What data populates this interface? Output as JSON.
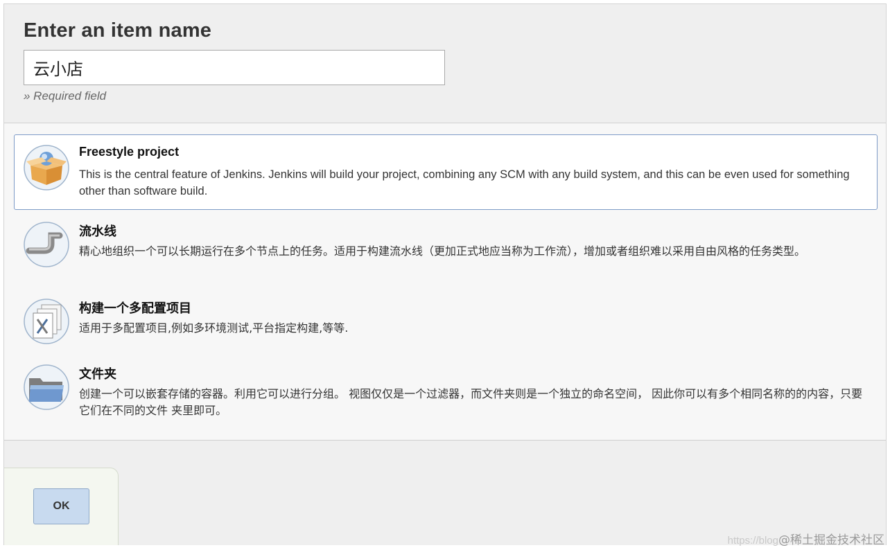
{
  "header": {
    "title": "Enter an item name",
    "item_name_value": "云小店",
    "required_note": "» Required field"
  },
  "items": [
    {
      "title": "Freestyle project",
      "description": "This is the central feature of Jenkins. Jenkins will build your project, combining any SCM with any build system, and this can be even used for something other than software build.",
      "icon": "freestyle-box-icon",
      "selected": true
    },
    {
      "title": "流水线",
      "description": "精心地组织一个可以长期运行在多个节点上的任务。适用于构建流水线（更加正式地应当称为工作流），增加或者组织难以采用自由风格的任务类型。",
      "icon": "pipeline-icon",
      "selected": false
    },
    {
      "title": "构建一个多配置项目",
      "description": "适用于多配置项目,例如多环境测试,平台指定构建,等等.",
      "icon": "multi-config-icon",
      "selected": false
    },
    {
      "title": "文件夹",
      "description": "创建一个可以嵌套存储的容器。利用它可以进行分组。 视图仅仅是一个过滤器，而文件夹则是一个独立的命名空间， 因此你可以有多个相同名称的的内容，只要它们在不同的文件 夹里即可。",
      "icon": "folder-icon",
      "selected": false
    }
  ],
  "footer": {
    "ok_label": "OK"
  },
  "watermark": {
    "url": "https://blog",
    "text": "@稀土掘金技术社区"
  },
  "colors": {
    "selected_border": "#7d9bc7",
    "ok_button": "#c8daef"
  }
}
